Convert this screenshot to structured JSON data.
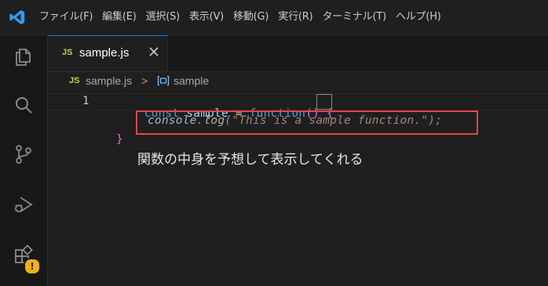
{
  "menu": [
    "ファイル(F)",
    "編集(E)",
    "選択(S)",
    "表示(V)",
    "移動(G)",
    "実行(R)",
    "ターミナル(T)",
    "ヘルプ(H)"
  ],
  "activity_icons": [
    "explorer-icon",
    "search-icon",
    "source-control-icon",
    "run-debug-icon",
    "extensions-icon"
  ],
  "warning_badge": "!",
  "tab": {
    "badge": "JS",
    "label": "sample.js",
    "close": "✕"
  },
  "breadcrumb": {
    "badge": "JS",
    "file": "sample.js",
    "separator": ">",
    "symbol": "sample"
  },
  "editor": {
    "line_numbers": [
      "1"
    ],
    "line1": {
      "kw": "const",
      "name": "sample",
      "op": "=",
      "fn": "function",
      "parens": "()",
      "brace": "{"
    },
    "ghost": {
      "obj": "console",
      "dot": ".",
      "method": "log",
      "open": "(",
      "string": "\"This is a sample function.\"",
      "close": ");"
    },
    "closing_brace": "}",
    "annotation": "関数の中身を予想して表示してくれる"
  },
  "colors": {
    "accent": "#0078d4",
    "highlight_border": "#e84545",
    "warning": "#f2b10b"
  }
}
